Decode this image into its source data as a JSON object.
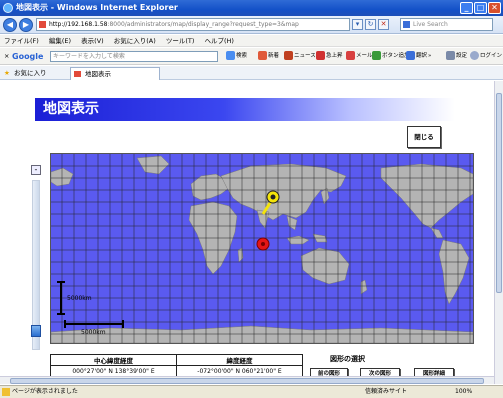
{
  "window": {
    "title": "地図表示 - Windows Internet Explorer",
    "minimize_glyph": "_",
    "maximize_glyph": "□",
    "close_glyph": "✕"
  },
  "address": {
    "back_glyph": "◀",
    "forward_glyph": "▶",
    "url_host": "http://192.168.1.58",
    "url_path": ":8000/administrators/map/display_range?request_type=3&map",
    "go_glyph": "▾",
    "refresh_glyph": "↻",
    "stop_glyph": "✕",
    "search_placeholder": "Live Search"
  },
  "menu": [
    "ファイル(F)",
    "編集(E)",
    "表示(V)",
    "お気に入り(A)",
    "ツール(T)",
    "ヘルプ(H)"
  ],
  "google_toolbar": {
    "close_glyph": "×",
    "logo": "Google",
    "search_placeholder": "キーワードを入力して検索",
    "search_button": "検索",
    "items": [
      "新着",
      "ニュース",
      "急上昇",
      "メール",
      "ボタン追加",
      "翻訳",
      "»",
      "設定",
      "ログイン"
    ]
  },
  "favorites": {
    "label": "お気に入り",
    "tab_label": "地図表示"
  },
  "page": {
    "title": "地図表示",
    "close_button": "閉じる",
    "zoom_minus": "-",
    "scale_vertical": "5000km",
    "scale_horizontal": "5000km"
  },
  "coordinates": {
    "center_header": "中心緯度経度",
    "center_value": "000°27'00\" N 138°39'00\" E",
    "range_header": "緯度経度",
    "range_value": "-072°00'00\" N 060°21'00\" E"
  },
  "figure_selection": {
    "title": "図形の選択",
    "prev_button": "前の図形",
    "next_button": "次の図形",
    "detail_button": "図形詳細"
  },
  "status": {
    "message": "ページが表示されました",
    "zone": "信頼済みサイト",
    "zoom": "100%"
  },
  "colors": {
    "heading_blue": "#1b1fd6",
    "ocean": "#5a5af0",
    "land": "#b4b4b4",
    "marker_yellow": "#f4e40a",
    "marker_red": "#e41616"
  }
}
